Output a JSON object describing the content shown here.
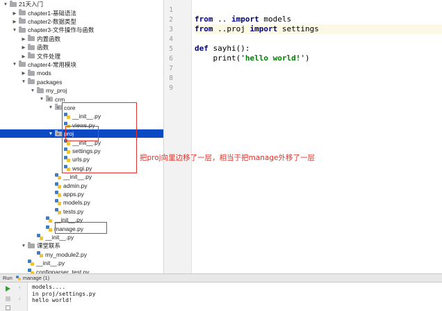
{
  "tree": {
    "rows": [
      {
        "label": "21天入门",
        "icon": "folder-icon",
        "arrow": "▼",
        "indent": 0
      },
      {
        "label": "chapter1-基础语法",
        "icon": "folder-icon",
        "arrow": "▶",
        "indent": 1
      },
      {
        "label": "chapter2-数据类型",
        "icon": "folder-icon",
        "arrow": "▶",
        "indent": 1
      },
      {
        "label": "chapter3-文件操作与函数",
        "icon": "folder-icon",
        "arrow": "▼",
        "indent": 1
      },
      {
        "label": "内置函数",
        "icon": "folder-icon",
        "arrow": "▶",
        "indent": 2
      },
      {
        "label": "函数",
        "icon": "folder-icon",
        "arrow": "▶",
        "indent": 2
      },
      {
        "label": "文件处理",
        "icon": "folder-icon",
        "arrow": "▶",
        "indent": 2
      },
      {
        "label": "chapter4-常用模块",
        "icon": "folder-icon",
        "arrow": "▼",
        "indent": 1
      },
      {
        "label": "mods",
        "icon": "folder-icon",
        "arrow": "▶",
        "indent": 2
      },
      {
        "label": "packages",
        "icon": "folder-icon",
        "arrow": "▼",
        "indent": 2
      },
      {
        "label": "my_proj",
        "icon": "folder-icon",
        "arrow": "▼",
        "indent": 3
      },
      {
        "label": "crm",
        "icon": "package-icon",
        "arrow": "▼",
        "indent": 4
      },
      {
        "label": "core",
        "icon": "package-icon",
        "arrow": "▼",
        "indent": 5
      },
      {
        "label": "__init__.py",
        "icon": "python-file-icon",
        "arrow": "",
        "indent": 6
      },
      {
        "label": "views.py",
        "icon": "python-file-icon",
        "arrow": "",
        "indent": 6
      },
      {
        "label": "proj",
        "icon": "package-icon",
        "arrow": "▼",
        "indent": 5,
        "selected": true
      },
      {
        "label": "__init__.py",
        "icon": "python-file-icon",
        "arrow": "",
        "indent": 6
      },
      {
        "label": "settings.py",
        "icon": "python-file-icon",
        "arrow": "",
        "indent": 6
      },
      {
        "label": "urls.py",
        "icon": "python-file-icon",
        "arrow": "",
        "indent": 6
      },
      {
        "label": "wsgi.py",
        "icon": "python-file-icon",
        "arrow": "",
        "indent": 6
      },
      {
        "label": "__init__.py",
        "icon": "python-file-icon",
        "arrow": "",
        "indent": 5
      },
      {
        "label": "admin.py",
        "icon": "python-file-icon",
        "arrow": "",
        "indent": 5
      },
      {
        "label": "apps.py",
        "icon": "python-file-icon",
        "arrow": "",
        "indent": 5
      },
      {
        "label": "models.py",
        "icon": "python-file-icon",
        "arrow": "",
        "indent": 5
      },
      {
        "label": "tests.py",
        "icon": "python-file-icon",
        "arrow": "",
        "indent": 5
      },
      {
        "label": "__init__.py",
        "icon": "python-file-icon",
        "arrow": "",
        "indent": 4
      },
      {
        "label": "manage.py",
        "icon": "python-file-icon",
        "arrow": "",
        "indent": 4
      },
      {
        "label": "__init__.py",
        "icon": "python-file-icon",
        "arrow": "",
        "indent": 3
      },
      {
        "label": "课堂联系",
        "icon": "folder-icon",
        "arrow": "▼",
        "indent": 2
      },
      {
        "label": "my_module2.py",
        "icon": "python-file-icon",
        "arrow": "",
        "indent": 3
      },
      {
        "label": "__init__.py",
        "icon": "python-file-icon",
        "arrow": "",
        "indent": 2
      },
      {
        "label": "configparser_test.py",
        "icon": "python-file-icon",
        "arrow": "",
        "indent": 2
      }
    ]
  },
  "editor": {
    "line_numbers": [
      "1",
      "2",
      "3",
      "4",
      "5",
      "6",
      "7",
      "8",
      "9"
    ],
    "lines": [
      [],
      [
        {
          "t": "from",
          "c": "kw"
        },
        {
          "t": " .. ",
          "c": ""
        },
        {
          "t": "import",
          "c": "kw"
        },
        {
          "t": " models",
          "c": ""
        }
      ],
      [
        {
          "t": "from",
          "c": "kw"
        },
        {
          "t": " ..proj ",
          "c": ""
        },
        {
          "t": "import",
          "c": "kw"
        },
        {
          "t": " settings",
          "c": ""
        }
      ],
      [],
      [
        {
          "t": "def",
          "c": "kw"
        },
        {
          "t": " sayhi():",
          "c": ""
        }
      ],
      [
        {
          "t": "    print(",
          "c": ""
        },
        {
          "t": "'hello world!'",
          "c": "str"
        },
        {
          "t": ")",
          "c": ""
        }
      ],
      [],
      [],
      []
    ],
    "highlight_line": 3
  },
  "annotation": "把proj向里边移了一层，相当于把manage外移了一层",
  "run": {
    "label": "Run",
    "config": "manage (1)",
    "output": [
      "models....",
      "in proj/settings.py",
      "hello world!"
    ]
  },
  "colors": {
    "selection": "#0c49c4",
    "annotation": "#e0312b",
    "keyword": "#000080",
    "string": "#008000"
  }
}
